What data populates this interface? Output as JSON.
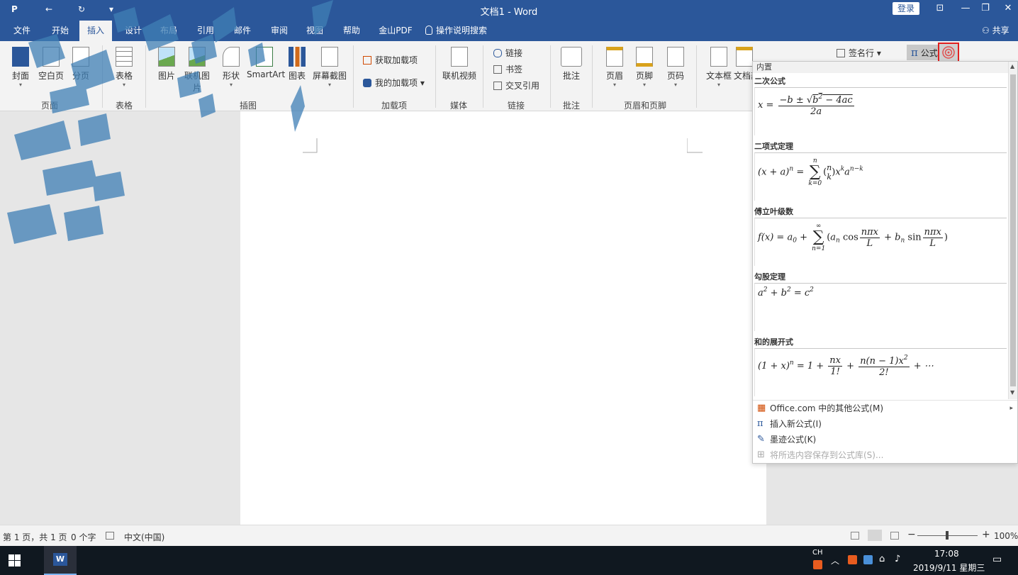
{
  "titlebar": {
    "app_icon": "P",
    "title": "文档1  -  Word",
    "login": "登录",
    "qa_items": [
      "←",
      "↻",
      "▾"
    ],
    "window_controls": [
      "⊡",
      "—",
      "❐",
      "✕"
    ]
  },
  "tabs": [
    {
      "label": "文件"
    },
    {
      "label": "开始"
    },
    {
      "label": "插入",
      "active": true
    },
    {
      "label": "设计"
    },
    {
      "label": "布局"
    },
    {
      "label": "引用"
    },
    {
      "label": "邮件"
    },
    {
      "label": "审阅"
    },
    {
      "label": "视图"
    },
    {
      "label": "帮助"
    },
    {
      "label": "金山PDF"
    }
  ],
  "tell_me": "操作说明搜索",
  "share": "共享",
  "ribbon": {
    "pages": {
      "cover": "封面",
      "blank": "空白页",
      "break": "分页",
      "label": "页面"
    },
    "tables": {
      "table": "表格",
      "label": "表格"
    },
    "illustrations": {
      "pictures": "图片",
      "online_pictures": "联机图片",
      "shapes": "形状",
      "smartart": "SmartArt",
      "chart": "图表",
      "screenshot": "屏幕截图",
      "label": "插图"
    },
    "addins": {
      "get": "获取加载项",
      "mine": "我的加载项",
      "label": "加载项"
    },
    "media": {
      "video": "联机视频",
      "label": "媒体"
    },
    "links": {
      "link": "链接",
      "bookmark": "书签",
      "cross_ref": "交叉引用",
      "label": "链接"
    },
    "comments": {
      "comment": "批注",
      "label": "批注"
    },
    "header_footer": {
      "header": "页眉",
      "footer": "页脚",
      "page_number": "页码",
      "label": "页眉和页脚"
    },
    "text": {
      "textbox": "文本框",
      "docparts": "文档部件",
      "signature": "签名行"
    },
    "symbols": {
      "equation": "公式"
    }
  },
  "gallery": {
    "header": "内置",
    "items": [
      {
        "title": "二次公式"
      },
      {
        "title": "二项式定理"
      },
      {
        "title": "傅立叶级数"
      },
      {
        "title": "勾股定理"
      },
      {
        "title": "和的展开式"
      }
    ],
    "menu": [
      {
        "label": "Office.com 中的其他公式(M)",
        "enabled": true
      },
      {
        "label": "插入新公式(I)",
        "enabled": true
      },
      {
        "label": "墨迹公式(K)",
        "enabled": true
      },
      {
        "label": "将所选内容保存到公式库(S)...",
        "enabled": false
      }
    ]
  },
  "status": {
    "page": "第 1 页，共 1 页",
    "words": "0 个字",
    "language": "中文(中国)",
    "zoom": "100%"
  },
  "taskbar": {
    "ime": "CH",
    "time": "17:08",
    "date": "2019/9/11 星期三"
  },
  "colors": {
    "brand": "#2b579a",
    "highlight": "#e02020"
  }
}
